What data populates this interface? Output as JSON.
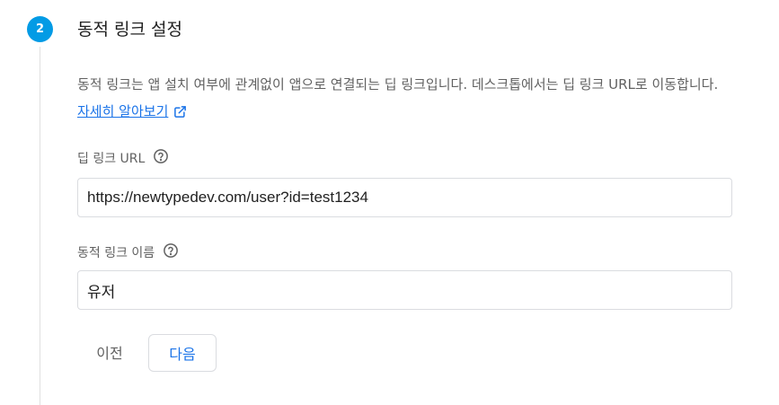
{
  "step": {
    "number": "2",
    "title": "동적 링크 설정"
  },
  "description": {
    "text": "동적 링크는 앱 설치 여부에 관계없이 앱으로 연결되는 딥 링크입니다. 데스크톱에서는 딥 링크 URL로 이동합니다. ",
    "learn_more": "자세히 알아보기",
    "learn_more_icon": "external-link-icon"
  },
  "deep_link": {
    "label": "딥 링크 URL",
    "help_icon": "help-circle-icon",
    "value": "https://newtypedev.com/user?id=test1234"
  },
  "link_name": {
    "label": "동적 링크 이름",
    "help_icon": "help-circle-icon",
    "value": "유저"
  },
  "actions": {
    "prev_label": "이전",
    "next_label": "다음"
  },
  "colors": {
    "accent": "#039be5",
    "link": "#1a73e8"
  }
}
